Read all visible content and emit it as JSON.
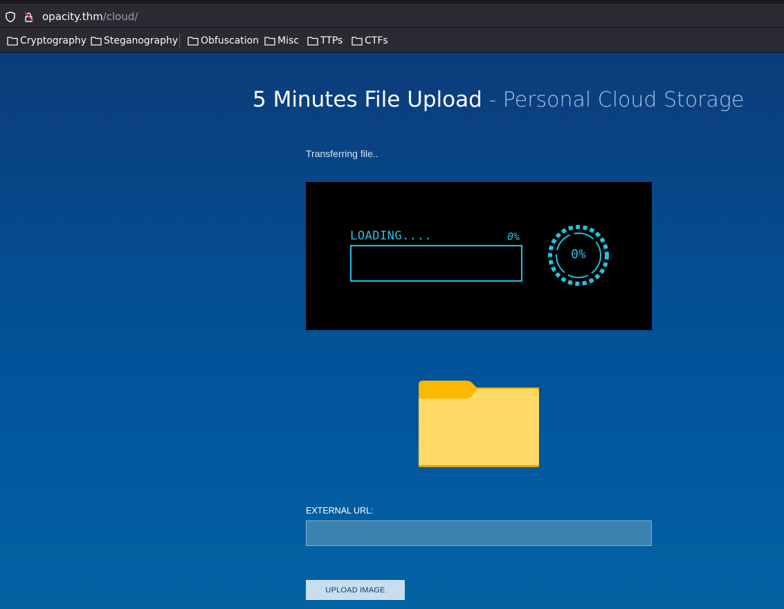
{
  "browser": {
    "url_host": "opacity.thm",
    "url_path": "/cloud/",
    "icons": [
      "shield-icon",
      "lock-warning-icon"
    ]
  },
  "bookmarks": [
    {
      "label": "Cryptography",
      "icon": "folder-icon"
    },
    {
      "label": "Steganography",
      "icon": "folder-icon"
    },
    {
      "label": "Obfuscation",
      "icon": "folder-icon"
    },
    {
      "label": "Misc",
      "icon": "folder-icon"
    },
    {
      "label": "TTPs",
      "icon": "folder-icon"
    },
    {
      "label": "CTFs",
      "icon": "folder-icon"
    }
  ],
  "page": {
    "title_main": "5 Minutes File Upload",
    "title_sub": " - Personal Cloud Storage",
    "status_text": "Transferring file..",
    "loader": {
      "label": "LOADING....",
      "percent_text": "0%",
      "gauge_text": "0%",
      "progress_fraction": 0
    },
    "folder_icon": "folder-icon",
    "external_url_label": "EXTERNAL URL:",
    "external_url_value": "",
    "upload_button_label": "UPLOAD IMAGE"
  },
  "colors": {
    "accent_cyan": "#22c3e6",
    "folder_yellow": "#ffd966",
    "folder_tab": "#ffb700",
    "page_bg_top": "#0c3c7a",
    "page_bg_bottom": "#0263a3"
  }
}
